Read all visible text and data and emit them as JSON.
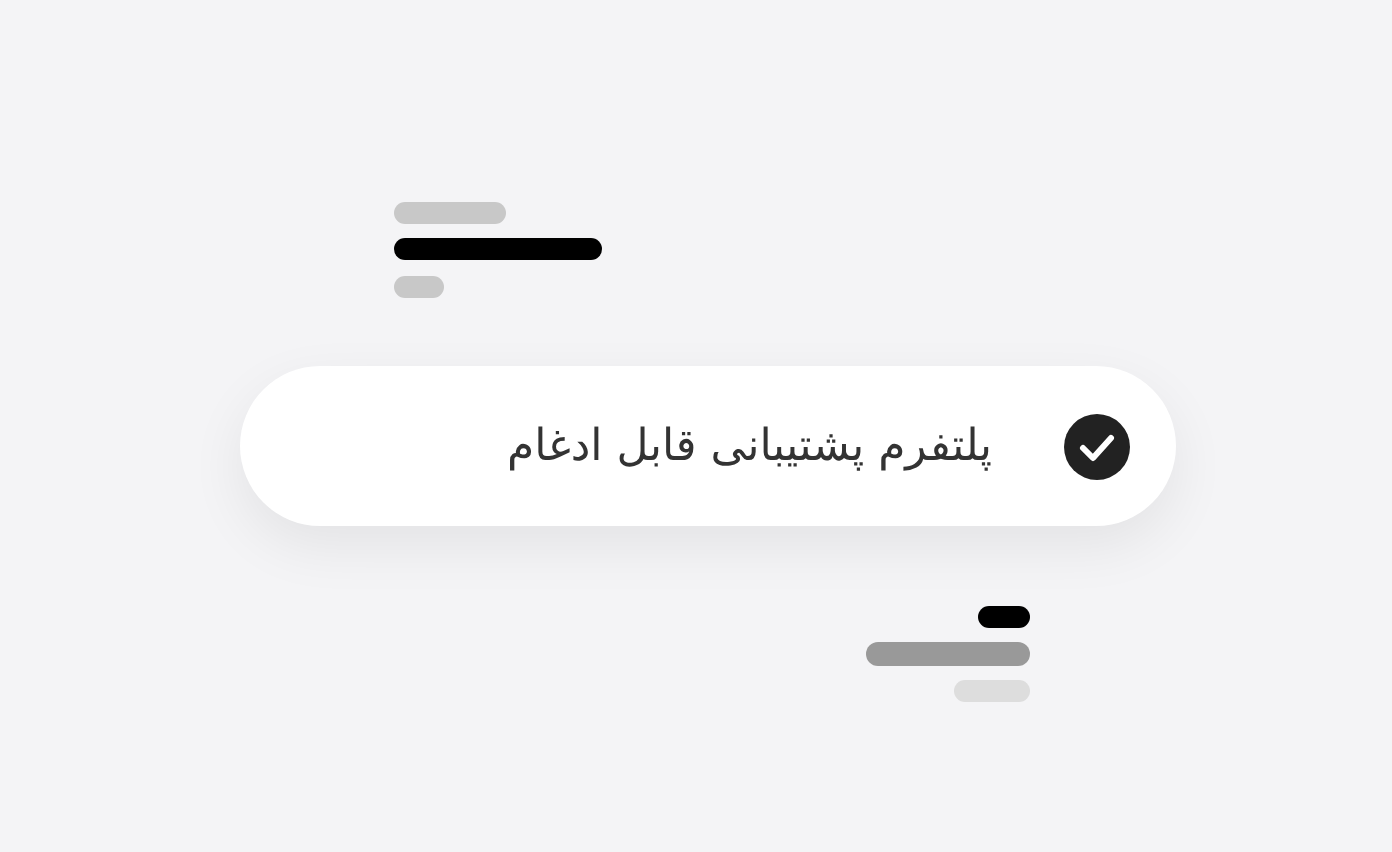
{
  "feature_pill": {
    "label": "پلتفرم پشتیبانی قابل ادغام",
    "checked": true
  }
}
